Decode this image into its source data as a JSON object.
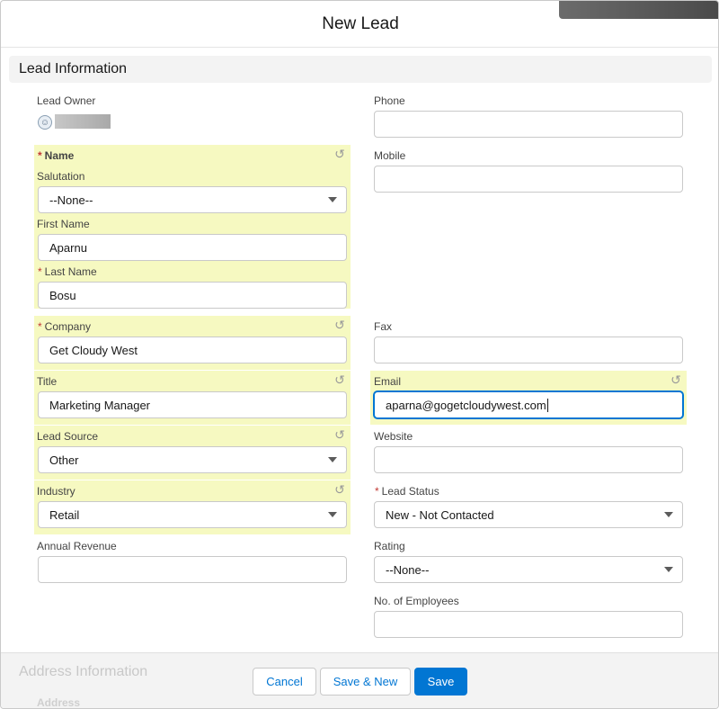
{
  "modal": {
    "title": "New Lead"
  },
  "section": {
    "title": "Lead Information"
  },
  "left": {
    "lead_owner_label": "Lead Owner",
    "name_label": "Name",
    "salutation_label": "Salutation",
    "salutation_value": "--None--",
    "first_name_label": "First Name",
    "first_name_value": "Aparnu",
    "last_name_label": "Last Name",
    "last_name_value": "Bosu",
    "company_label": "Company",
    "company_value": "Get Cloudy West",
    "title_label": "Title",
    "title_value": "Marketing Manager",
    "lead_source_label": "Lead Source",
    "lead_source_value": "Other",
    "industry_label": "Industry",
    "industry_value": "Retail",
    "annual_revenue_label": "Annual Revenue",
    "annual_revenue_value": ""
  },
  "right": {
    "phone_label": "Phone",
    "phone_value": "",
    "mobile_label": "Mobile",
    "mobile_value": "",
    "fax_label": "Fax",
    "fax_value": "",
    "email_label": "Email",
    "email_value": "aparna@gogetcloudywest.com",
    "website_label": "Website",
    "website_value": "",
    "lead_status_label": "Lead Status",
    "lead_status_value": "New - Not Contacted",
    "rating_label": "Rating",
    "rating_value": "--None--",
    "employees_label": "No. of Employees",
    "employees_value": ""
  },
  "footer": {
    "address_section": "Address Information",
    "address_label": "Address",
    "cancel_label": "Cancel",
    "save_new_label": "Save & New",
    "save_label": "Save"
  },
  "icons": {
    "undo": "undo-icon",
    "dropdown": "chevron-down-icon",
    "avatar": "user-avatar-icon"
  },
  "colors": {
    "brand": "#0176d3",
    "highlight": "#f6f9c1",
    "required": "#c23934"
  }
}
